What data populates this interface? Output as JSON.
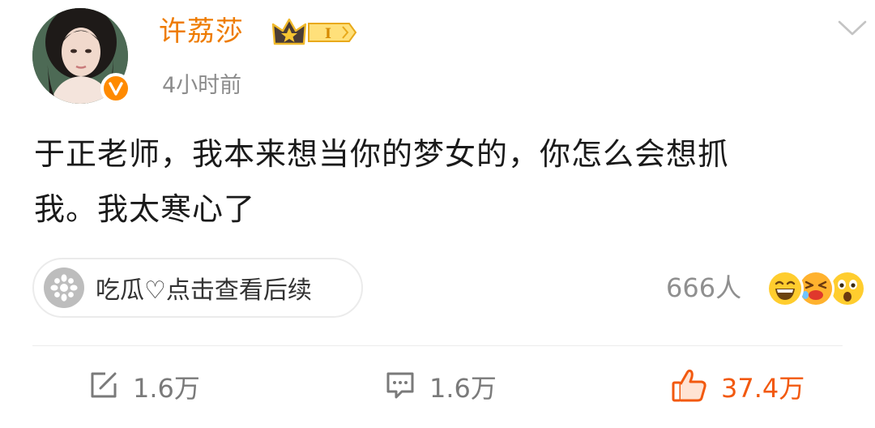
{
  "post": {
    "author": {
      "name": "许荔莎",
      "verified_icon": "verified-v-icon",
      "badge_icon": "crown-badge-icon",
      "badge_level": "I"
    },
    "timestamp": "4小时前",
    "text_line1": "于正老师，我本来想当你的梦女的，你怎么会想抓",
    "text_line2": "我。我太寒心了",
    "topic_link": {
      "icon": "melon-icon",
      "label": "吃瓜♡点击查看后续"
    },
    "reactions": {
      "count": "666人",
      "emojis": [
        "grinning-face-icon",
        "laughing-face-icon",
        "shocked-face-icon"
      ]
    }
  },
  "actions": {
    "repost": {
      "icon": "repost-icon",
      "count": "1.6万"
    },
    "comment": {
      "icon": "comment-icon",
      "count": "1.6万"
    },
    "like": {
      "icon": "thumbs-up-icon",
      "count": "37.4万"
    }
  },
  "colors": {
    "author_name": "#ee7b00",
    "like_active": "#f2590f",
    "muted": "#8c8c8c",
    "text": "#1a1a1a"
  }
}
